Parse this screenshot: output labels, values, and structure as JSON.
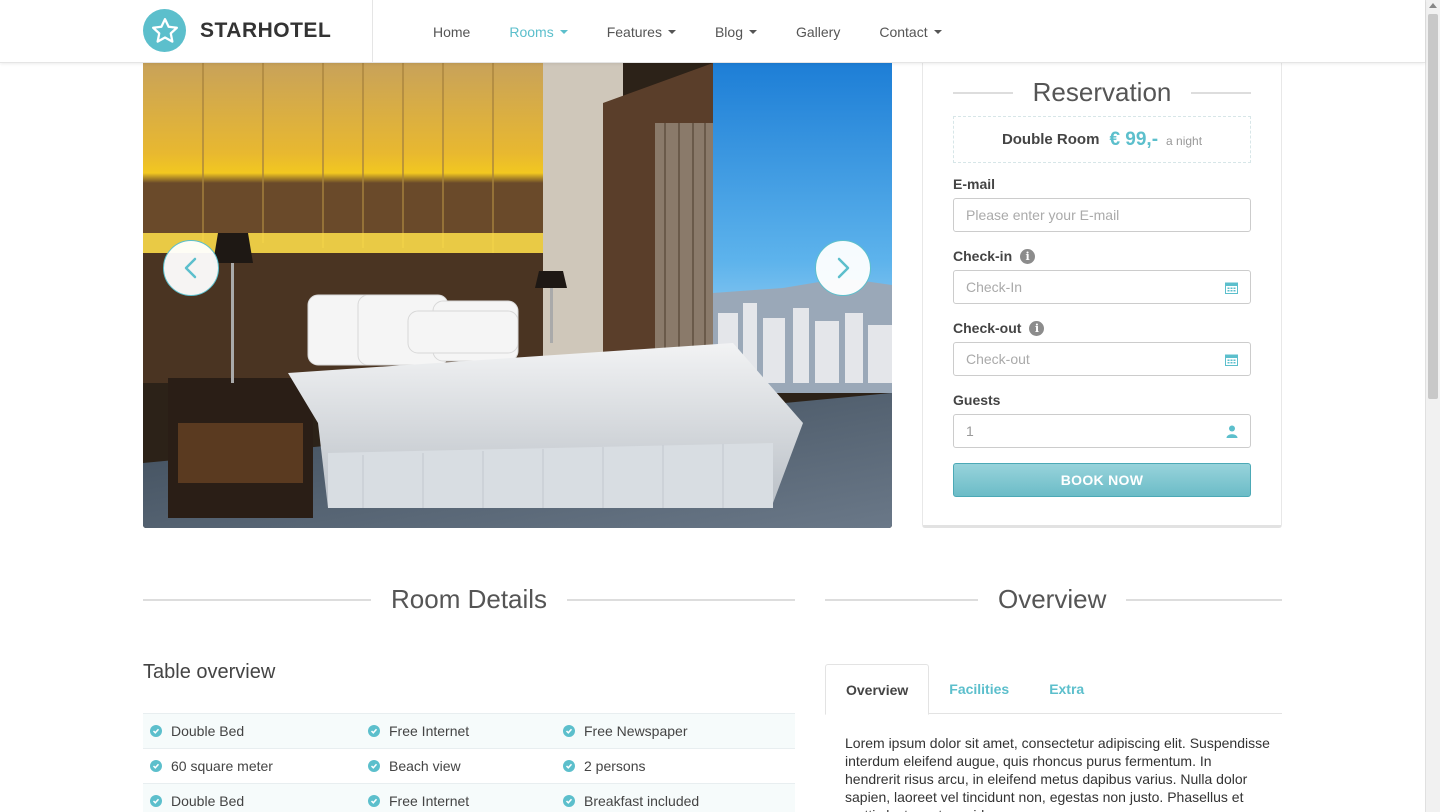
{
  "header": {
    "brand": "STARHOTEL",
    "nav": [
      {
        "label": "Home",
        "dropdown": false,
        "active": false
      },
      {
        "label": "Rooms",
        "dropdown": true,
        "active": true
      },
      {
        "label": "Features",
        "dropdown": true,
        "active": false
      },
      {
        "label": "Blog",
        "dropdown": true,
        "active": false
      },
      {
        "label": "Gallery",
        "dropdown": false,
        "active": false
      },
      {
        "label": "Contact",
        "dropdown": true,
        "active": false
      }
    ]
  },
  "colors": {
    "accent": "#5cbfcc",
    "text": "#444444"
  },
  "hero": {
    "prev_icon": "chevron-left-icon",
    "next_icon": "chevron-right-icon"
  },
  "reservation": {
    "title": "Reservation",
    "room_name": "Double Room",
    "price": "€ 99,-",
    "price_unit": "a night",
    "email": {
      "label": "E-mail",
      "placeholder": "Please enter your E-mail"
    },
    "checkin": {
      "label": "Check-in",
      "placeholder": "Check-In"
    },
    "checkout": {
      "label": "Check-out",
      "placeholder": "Check-out"
    },
    "guests": {
      "label": "Guests",
      "value": "1"
    },
    "book_button": "BOOK NOW"
  },
  "room_details": {
    "title": "Room Details",
    "table_title": "Table overview",
    "rows": [
      [
        "Double Bed",
        "Free Internet",
        "Free Newspaper"
      ],
      [
        "60 square meter",
        "Beach view",
        "2 persons"
      ],
      [
        "Double Bed",
        "Free Internet",
        "Breakfast included"
      ]
    ]
  },
  "overview": {
    "title": "Overview",
    "tabs": [
      "Overview",
      "Facilities",
      "Extra"
    ],
    "active_tab": "Overview",
    "text": "Lorem ipsum dolor sit amet, consectetur adipiscing elit. Suspendisse interdum eleifend augue, quis rhoncus purus fermentum. In hendrerit risus arcu, in eleifend metus dapibus varius. Nulla dolor sapien, laoreet vel tincidunt non, egestas non justo. Phasellus et mattis lectus, et gravida"
  }
}
